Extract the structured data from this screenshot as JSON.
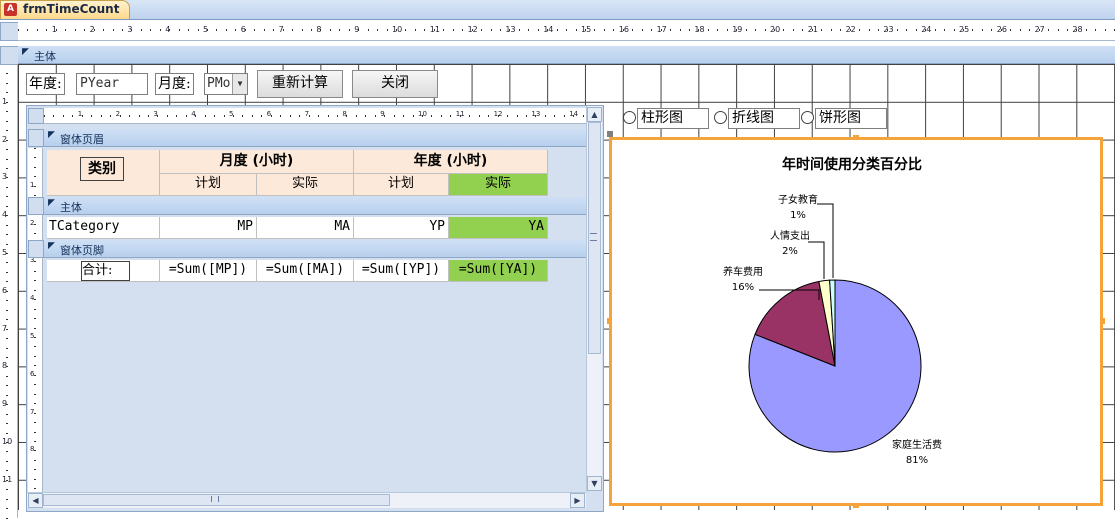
{
  "window": {
    "tab_title": "frmTimeCount",
    "tab_icon": "A"
  },
  "ruler": {
    "h_numbers": [
      "1",
      "2",
      "3",
      "4",
      "5",
      "6",
      "7",
      "8",
      "9",
      "10",
      "11",
      "12",
      "13",
      "14",
      "15",
      "16",
      "17",
      "18",
      "19",
      "20",
      "21",
      "22",
      "23",
      "24",
      "25",
      "26",
      "27",
      "28"
    ],
    "v_numbers": [
      "1",
      "2",
      "3",
      "4",
      "5",
      "6",
      "7",
      "8",
      "9",
      "10",
      "11"
    ],
    "sub_h_numbers": [
      "1",
      "2",
      "3",
      "4",
      "5",
      "6",
      "7",
      "8",
      "9",
      "10",
      "11",
      "12",
      "13",
      "14"
    ],
    "sub_v_numbers": [
      "1",
      "2",
      "3",
      "4",
      "5",
      "6",
      "7",
      "8",
      "9",
      "10",
      "11"
    ]
  },
  "main_section": {
    "label": "主体"
  },
  "filters": {
    "year_label": "年度:",
    "year_value": "PYear",
    "month_label": "月度:",
    "month_value": "PMo",
    "recalc_button": "重新计算",
    "close_button": "关闭"
  },
  "subform": {
    "header_section": "窗体页眉",
    "detail_section": "主体",
    "footer_section": "窗体页脚",
    "category_header": "类别",
    "month_header": "月度 (小时)",
    "year_header": "年度 (小时)",
    "plan_label": "计划",
    "actual_label": "实际",
    "detail_row": [
      "TCategory",
      "MP",
      "MA",
      "YP",
      "YA"
    ],
    "footer_label": "合计:",
    "footer_row": [
      "=Sum([MP])",
      "=Sum([MA])",
      "=Sum([YP])",
      "=Sum([YA])"
    ]
  },
  "chart_options": {
    "options": [
      "柱形图",
      "折线图",
      "饼形图"
    ]
  },
  "colors": {
    "accent_orange": "#f4a43a",
    "highlight_green": "#92d050",
    "header_peach": "#fde9d9"
  },
  "chart_data": {
    "type": "pie",
    "title": "年时间使用分类百分比",
    "slices": [
      {
        "label": "家庭生活费",
        "pct_text": "81%",
        "value": 81,
        "color": "#9999ff"
      },
      {
        "label": "养车费用",
        "pct_text": "16%",
        "value": 16,
        "color": "#993366"
      },
      {
        "label": "人情支出",
        "pct_text": "2%",
        "value": 2,
        "color": "#ffffcc"
      },
      {
        "label": "子女教育",
        "pct_text": "1%",
        "value": 1,
        "color": "#ccffff"
      }
    ]
  }
}
